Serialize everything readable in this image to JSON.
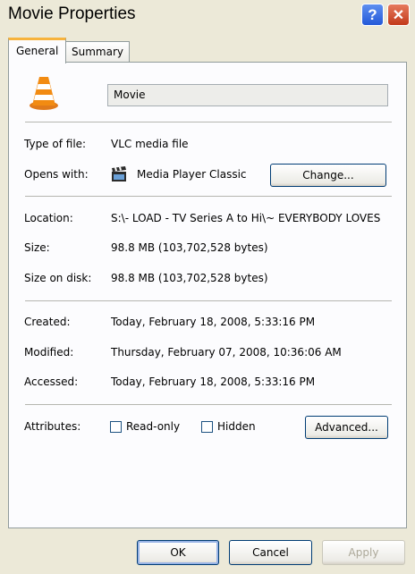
{
  "window": {
    "title": "Movie Properties"
  },
  "tabs": [
    {
      "label": "General"
    },
    {
      "label": "Summary"
    }
  ],
  "general": {
    "file_name": "Movie",
    "type_label": "Type of file:",
    "type_value": "VLC media file",
    "opens_label": "Opens with:",
    "opens_value": "Media Player Classic",
    "change_button": "Change...",
    "location_label": "Location:",
    "location_value": "S:\\- LOAD - TV Series A to Hi\\~ EVERYBODY LOVES",
    "size_label": "Size:",
    "size_value": "98.8 MB (103,702,528 bytes)",
    "size_disk_label": "Size on disk:",
    "size_disk_value": "98.8 MB (103,702,528 bytes)",
    "created_label": "Created:",
    "created_value": "Today, February 18, 2008, 5:33:16 PM",
    "modified_label": "Modified:",
    "modified_value": "Thursday, February 07, 2008, 10:36:06 AM",
    "accessed_label": "Accessed:",
    "accessed_value": "Today, February 18, 2008, 5:33:16 PM",
    "attributes_label": "Attributes:",
    "readonly_label": "Read-only",
    "hidden_label": "Hidden",
    "advanced_button": "Advanced..."
  },
  "footer": {
    "ok": "OK",
    "cancel": "Cancel",
    "apply": "Apply"
  },
  "icons": {
    "file_icon": "vlc-cone-icon",
    "app_icon": "clapperboard-icon"
  }
}
